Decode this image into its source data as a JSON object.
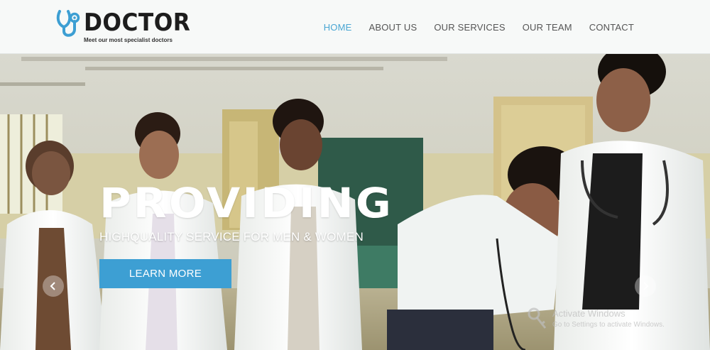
{
  "brand": {
    "name": "DOCTOR",
    "tagline": "Meet our most specialist doctors",
    "icon": "stethoscope-icon",
    "accent_color": "#4aa6d3"
  },
  "nav": {
    "items": [
      {
        "label": "HOME",
        "active": true
      },
      {
        "label": "ABOUT US",
        "active": false
      },
      {
        "label": "OUR SERVICES",
        "active": false
      },
      {
        "label": "OUR TEAM",
        "active": false
      },
      {
        "label": "CONTACT",
        "active": false
      }
    ]
  },
  "hero": {
    "title": "PROVIDING",
    "subtitle": "HIGHQUALITY SERVICE FOR MEN & WOMEN",
    "cta_label": "LEARN MORE",
    "cta_color": "#3d9fd3",
    "prev_icon": "chevron-left-icon",
    "next_icon": "chevron-right-icon"
  },
  "watermark": {
    "line1": "Activate Windows",
    "line2": "Go to Settings to activate Windows."
  }
}
